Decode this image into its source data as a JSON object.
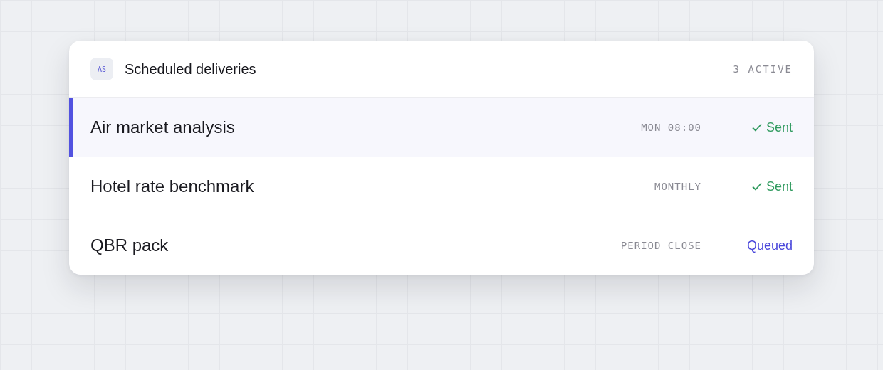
{
  "header": {
    "badge": "AS",
    "title": "Scheduled deliveries",
    "count": "3 ACTIVE"
  },
  "rows": [
    {
      "name": "Air market analysis",
      "schedule": "MON 08:00",
      "status": "Sent",
      "kind": "sent",
      "selected": true
    },
    {
      "name": "Hotel rate benchmark",
      "schedule": "MONTHLY",
      "status": "Sent",
      "kind": "sent",
      "selected": false
    },
    {
      "name": "QBR pack",
      "schedule": "PERIOD CLOSE",
      "status": "Queued",
      "kind": "queued",
      "selected": false
    }
  ]
}
